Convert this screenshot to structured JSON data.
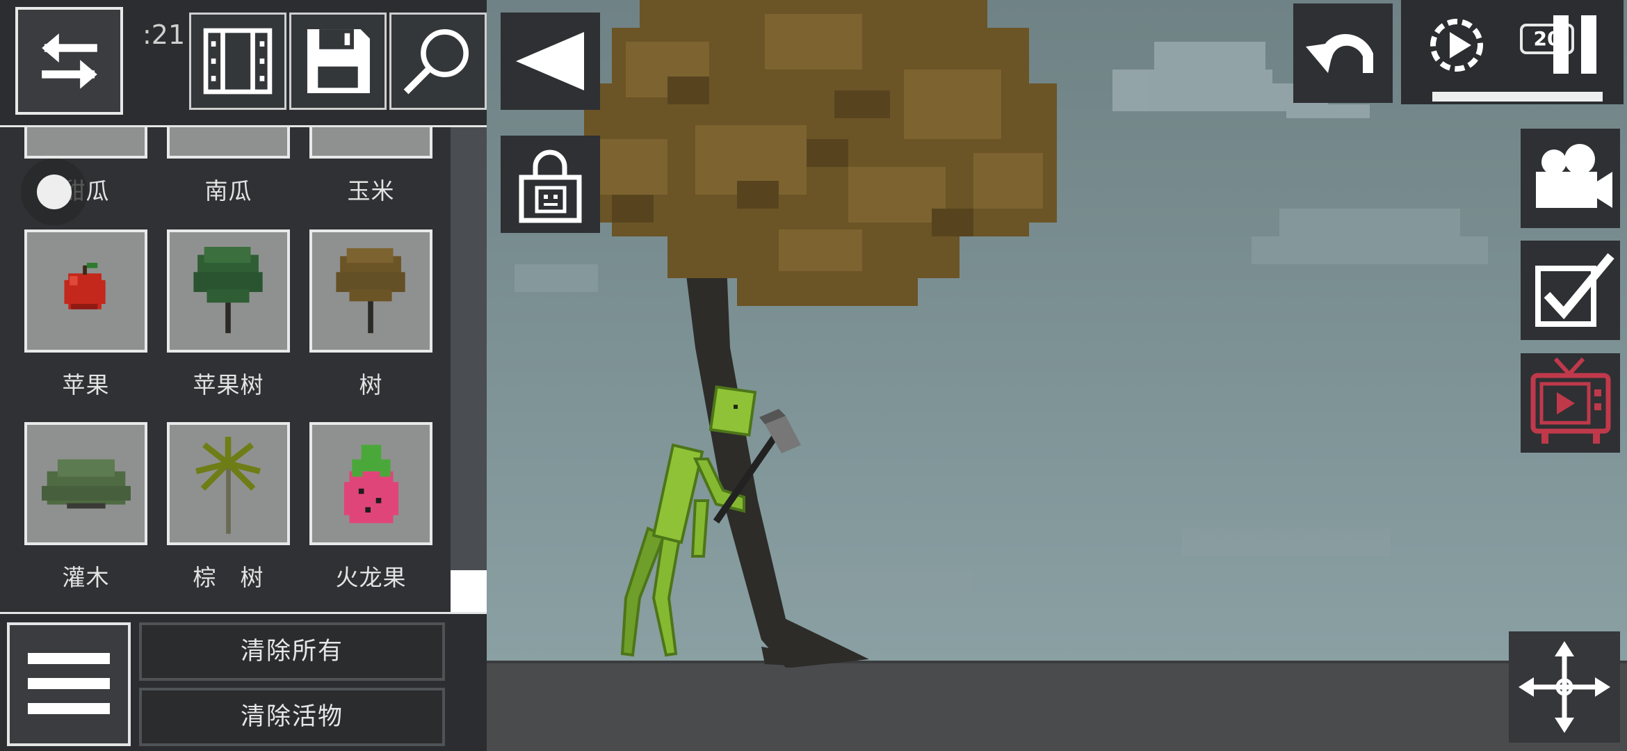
{
  "inventory": {
    "partial_row": [
      {
        "label": "甜瓜"
      },
      {
        "label": "南瓜"
      },
      {
        "label": "玉米"
      }
    ],
    "items": [
      {
        "label": "苹果",
        "icon": "apple-icon"
      },
      {
        "label": "苹果树",
        "icon": "apple-tree-icon"
      },
      {
        "label": "树",
        "icon": "tree-icon"
      },
      {
        "label": "灌木",
        "icon": "shrub-icon"
      },
      {
        "label": "棕　树",
        "icon": "palm-tree-icon"
      },
      {
        "label": "火龙果",
        "icon": "dragon-fruit-icon"
      }
    ],
    "clock_fragment": ":21"
  },
  "toolbar": {
    "icons": [
      "swap-arrows-icon",
      "film-strip-icon",
      "save-floppy-icon",
      "search-magnifier-icon"
    ]
  },
  "bottom": {
    "clear_all_label": "清除所有",
    "clear_living_label": "清除活物",
    "menu_icon": "hamburger-menu-icon"
  },
  "world_controls": {
    "collapse_icon": "collapse-left-triangle-icon",
    "lock_icon": "lock-face-icon",
    "undo_icon": "undo-arrow-icon",
    "slow_motion_icon": "slow-motion-play-icon",
    "speed_label": "20",
    "pause_icon": "pause-icon",
    "camera_icon": "video-camera-icon",
    "checkbox_icon": "checkbox-check-icon",
    "tv_icon": "tv-ad-icon",
    "move_icon": "move-arrows-icon"
  },
  "colors": {
    "panel_bg": "#2f3134",
    "item_bg": "#8f9190",
    "sky": "#7f9295",
    "ground": "#4a4b4d",
    "ad_red": "#c0394b"
  }
}
